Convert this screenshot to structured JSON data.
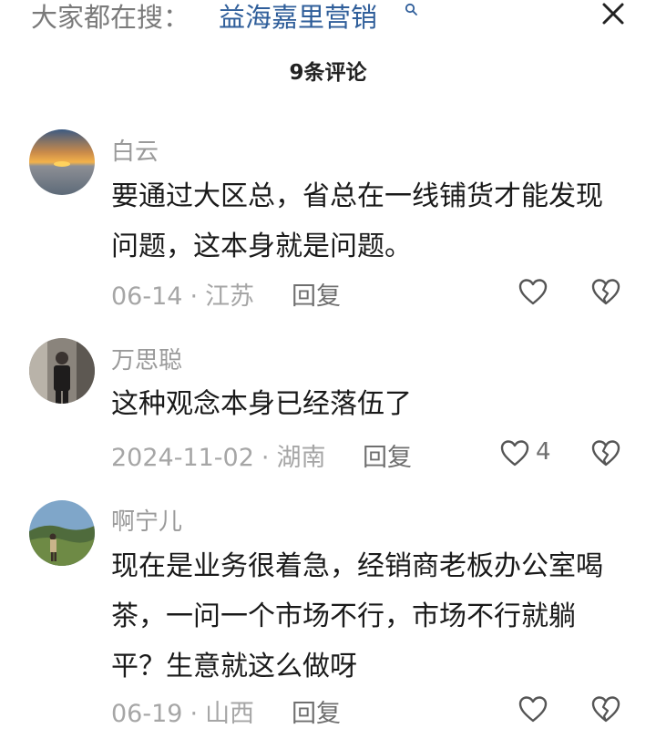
{
  "header": {
    "search_prefix": "大家都在搜：",
    "search_term": "益海嘉里营销",
    "comment_count_title": "9条评论"
  },
  "comments": [
    {
      "username": "白云",
      "text": "要通过大区总，省总在一线铺货才能发现问题，这本身就是问题。",
      "date": "06-14",
      "location": "江苏",
      "reply_label": "回复",
      "likes": ""
    },
    {
      "username": "万思聪",
      "text": "这种观念本身已经落伍了",
      "date": "2024-11-02",
      "location": "湖南",
      "reply_label": "回复",
      "likes": "4"
    },
    {
      "username": "啊宁儿",
      "text": "现在是业务很着急，经销商老板办公室喝茶，一问一个市场不行，市场不行就躺平？生意就这么做呀",
      "date": "06-19",
      "location": "山西",
      "reply_label": "回复",
      "likes": ""
    }
  ],
  "icons": {
    "search": "search-icon",
    "close": "close-icon",
    "like": "heart-icon",
    "dislike": "broken-heart-icon"
  },
  "colors": {
    "link": "#2f5e9a",
    "meta": "#a6a6a6",
    "text": "#1a1a1a"
  }
}
